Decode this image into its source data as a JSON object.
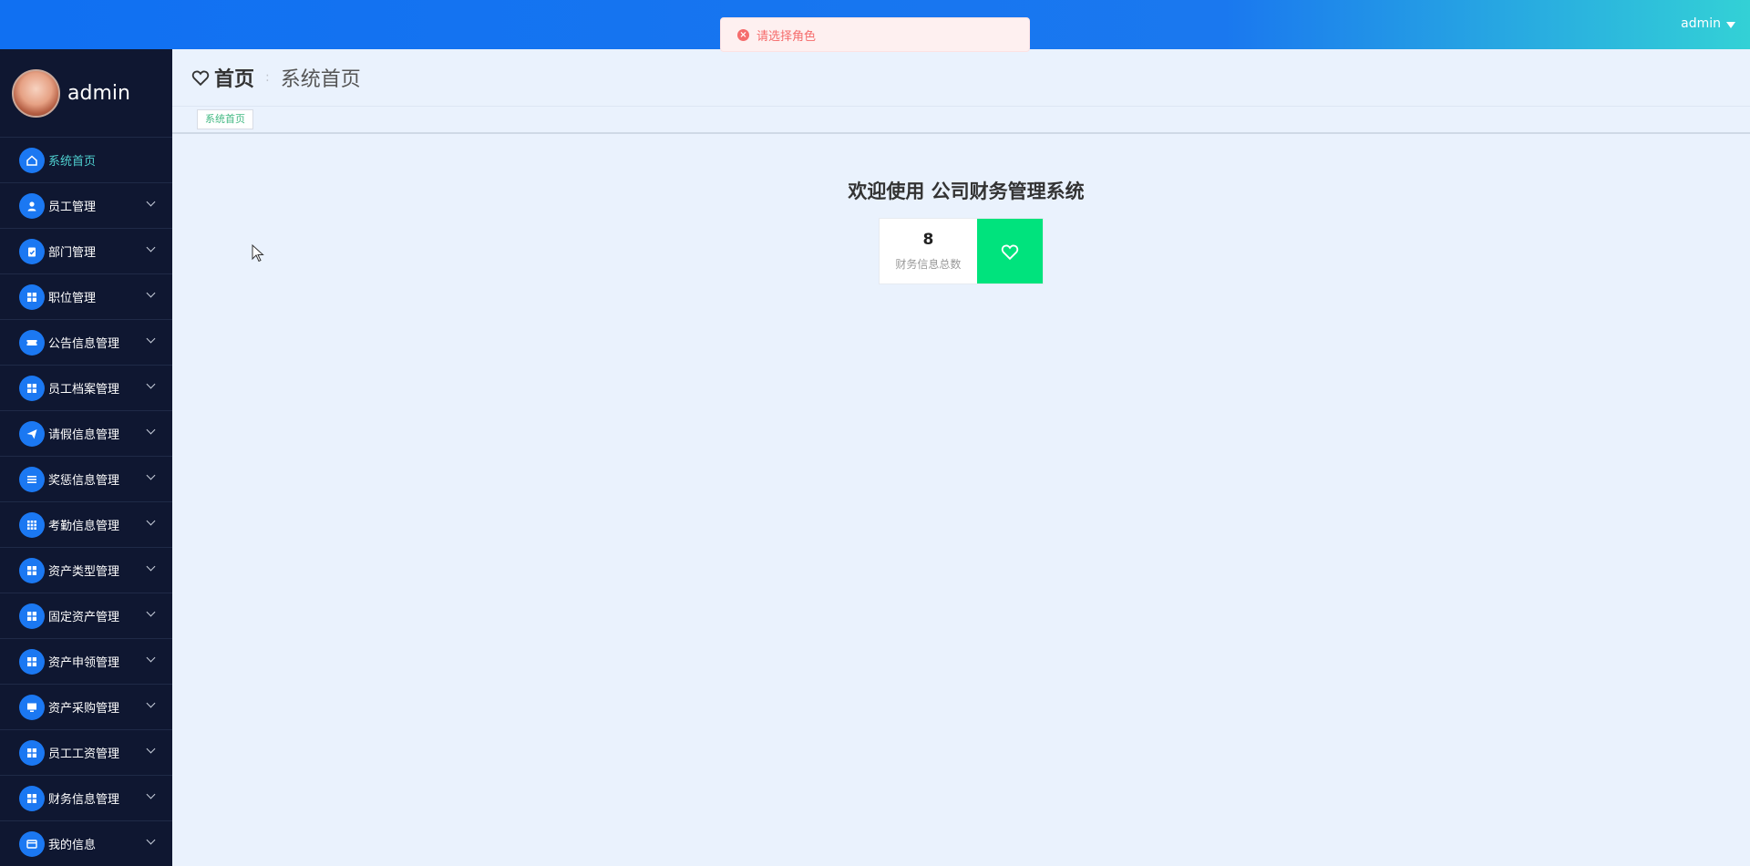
{
  "topbar": {
    "username": "admin"
  },
  "toast": {
    "message": "请选择角色",
    "color": "#f56c6c"
  },
  "sidebar": {
    "profile_name": "admin",
    "items": [
      {
        "label": "系统首页",
        "icon": "home-icon",
        "active": true
      },
      {
        "label": "员工管理",
        "icon": "user-icon"
      },
      {
        "label": "部门管理",
        "icon": "clipboard-icon"
      },
      {
        "label": "职位管理",
        "icon": "grid-icon"
      },
      {
        "label": "公告信息管理",
        "icon": "ticket-icon"
      },
      {
        "label": "员工档案管理",
        "icon": "grid-icon"
      },
      {
        "label": "请假信息管理",
        "icon": "send-icon"
      },
      {
        "label": "奖惩信息管理",
        "icon": "list-icon"
      },
      {
        "label": "考勤信息管理",
        "icon": "apps-icon"
      },
      {
        "label": "资产类型管理",
        "icon": "grid-icon"
      },
      {
        "label": "固定资产管理",
        "icon": "grid-icon"
      },
      {
        "label": "资产申领管理",
        "icon": "grid-icon"
      },
      {
        "label": "资产采购管理",
        "icon": "monitor-icon"
      },
      {
        "label": "员工工资管理",
        "icon": "grid-icon"
      },
      {
        "label": "财务信息管理",
        "icon": "grid-icon"
      },
      {
        "label": "我的信息",
        "icon": "card-icon"
      }
    ]
  },
  "header": {
    "title": "首页",
    "subtitle": "系统首页"
  },
  "tabs": {
    "active_tab": "系统首页"
  },
  "main": {
    "welcome": "欢迎使用 公司财务管理系统",
    "stat_value": "8",
    "stat_label": "财务信息总数",
    "accent_color": "#00e37d"
  }
}
